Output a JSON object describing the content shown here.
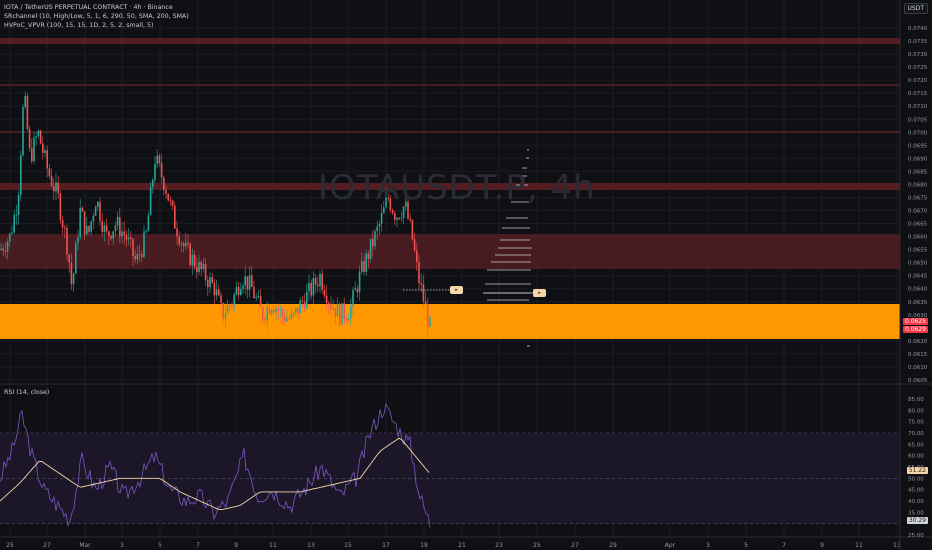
{
  "header": {
    "symbol_line": "IOTA / TetherUS PERPETUAL CONTRACT · 4h · Binance",
    "indicator_1": "SRchannel (10, High/Low, 5, 1, 6, 290, 50, SMA, 200, SMA)",
    "indicator_2": "HVPoC_VPVR (100, 15, 15, 1D, 2, 5, 2, small, 5)",
    "currency": "USDT"
  },
  "watermark": "IOTAUSDT.P, 4h",
  "price_axis": {
    "labels": [
      "0.0740",
      "0.0735",
      "0.0730",
      "0.0725",
      "0.0720",
      "0.0715",
      "0.0710",
      "0.0705",
      "0.0700",
      "0.0695",
      "0.0690",
      "0.0685",
      "0.0680",
      "0.0675",
      "0.0670",
      "0.0665",
      "0.0660",
      "0.0655",
      "0.0650",
      "0.0645",
      "0.0640",
      "0.0635",
      "0.0630",
      "0.0620",
      "0.0615",
      "0.0610",
      "0.0605"
    ],
    "current_price": "0.0625",
    "current_price_2": "0.0629",
    "current_color": "#f23645"
  },
  "rsi": {
    "label": "RSI (14, close)",
    "axis_labels": [
      "85.00",
      "80.00",
      "75.00",
      "70.00",
      "65.00",
      "60.00",
      "55.00",
      "50.00",
      "45.00",
      "40.00",
      "35.00",
      "25.00"
    ],
    "rsi_value": "51.22",
    "rsi_ma_value": "30.29"
  },
  "time_axis": {
    "labels": [
      "25",
      "27",
      "Mar",
      "3",
      "5",
      "7",
      "9",
      "11",
      "13",
      "15",
      "17",
      "19",
      "21",
      "23",
      "25",
      "27",
      "29",
      "Apr",
      "3",
      "5",
      "7",
      "9",
      "11",
      "13"
    ]
  },
  "colors": {
    "background": "#0f1014",
    "up_candle": "#26a69a",
    "down_candle": "#ef5350",
    "resistance_zone": "#5b1f23",
    "support_zone": "#ff9800",
    "rsi_line": "#7e57c2",
    "rsi_ma": "#f5d6a8"
  },
  "markers": {
    "tag_1": "▸",
    "tag_2": "▸"
  }
}
